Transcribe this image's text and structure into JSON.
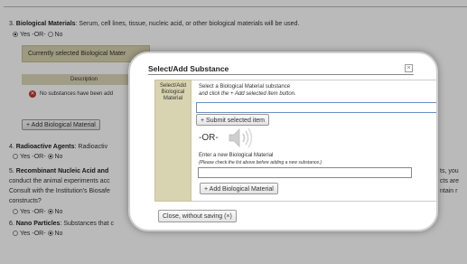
{
  "background": {
    "q3_label": "3. ",
    "q3_title": "Biological Materials",
    "q3_text": ": Serum, cell lines, tissue, nucleic acid, or other biological materials will be used.",
    "q3_yes": "Yes",
    "q3_or": "-OR-",
    "q3_no": "No",
    "selected_panel_text": "Currently selected Biological Mater",
    "table_header": "Description",
    "no_substances": "No substances have been add",
    "add_button": "+ Add Biological Material",
    "q4_label": "4. ",
    "q4_title": "Radioactive Agents",
    "q4_text": ": Radioactiv",
    "q4_yes": "Yes",
    "q4_or": "-OR-",
    "q4_no": "No",
    "q5_label": "5. ",
    "q5_title": "Recombinant Nucleic Acid and",
    "q5_line2": "conduct the animal experiments acc",
    "q5_line3": "Consult with the Institution's Biosafe",
    "q5_line4": "constructs?",
    "q5_right1": "ts, you",
    "q5_right2": "cts are",
    "q5_right3": "ntain r",
    "q5_yes": "Yes",
    "q5_or": "-OR-",
    "q5_no": "No",
    "q6_label": "6. ",
    "q6_title": "Nano Particles",
    "q6_text": ": Substances that c",
    "q6_yes": "Yes",
    "q6_or": "-OR-",
    "q6_no": "No"
  },
  "modal": {
    "title": "Select/Add Substance",
    "close_icon_glyph": "×",
    "sidebar_label": "Select/Add Biological Material",
    "instruction_line1": "Select a Biological Material substance",
    "instruction_line2": "and click the + Add selected item button.",
    "search_value": "",
    "submit_button": "+ Submit selected item",
    "or_text": "-OR-",
    "new_label": "Enter a new Biological Material",
    "new_hint": "(Please check the list above before adding a new substance.)",
    "new_value": "",
    "add_button": "+ Add Biological Material",
    "close_button": "Close, without saving (×)"
  },
  "colors": {
    "panel_tan": "#d8d3b0",
    "error_red": "#c0392b",
    "overlay": "rgba(0,0,0,0.27)"
  },
  "icons": [
    "close-icon",
    "error-icon",
    "speaker-icon"
  ]
}
